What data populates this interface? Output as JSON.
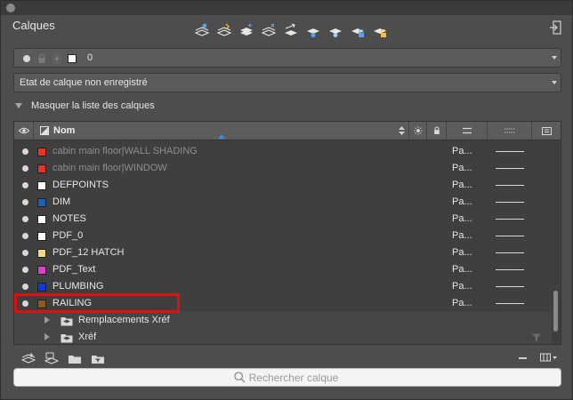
{
  "panel": {
    "title": "Calques"
  },
  "toolbar": {
    "icons": [
      "layer-match-icon",
      "layer-previous-icon",
      "layer-isolate-icon",
      "layer-unisolate-icon",
      "layer-walk-icon",
      "layer-freeze-icon",
      "layer-off-icon",
      "layer-lock-icon",
      "layer-unlock-icon"
    ]
  },
  "current_layer": {
    "name": "0",
    "color": "#ffffff"
  },
  "state": {
    "value": "Etat de calque non enregistré"
  },
  "toggle": {
    "label": "Masquer la liste des calques"
  },
  "list": {
    "header": {
      "name": "Nom"
    },
    "layers": [
      {
        "name": "cabin main floor|WALL SHADING",
        "color": "#e8322a",
        "linetype": "Pa...",
        "xref": true
      },
      {
        "name": "cabin main floor|WINDOW",
        "color": "#e8322a",
        "linetype": "Pa...",
        "xref": true
      },
      {
        "name": "DEFPOINTS",
        "color": "#ffffff",
        "linetype": "Pa...",
        "xref": false
      },
      {
        "name": "DIM",
        "color": "#1f5fb0",
        "linetype": "Pa...",
        "xref": false
      },
      {
        "name": "NOTES",
        "color": "#ffffff",
        "linetype": "Pa...",
        "xref": false
      },
      {
        "name": "PDF_0",
        "color": "#ffffff",
        "linetype": "Pa...",
        "xref": false
      },
      {
        "name": "PDF_12 HATCH",
        "color": "#f2d48a",
        "linetype": "Pa...",
        "xref": false
      },
      {
        "name": "PDF_Text",
        "color": "#e23fc8",
        "linetype": "Pa...",
        "xref": false
      },
      {
        "name": "PLUMBING",
        "color": "#1238d8",
        "linetype": "Pa...",
        "xref": false
      },
      {
        "name": "RAILING",
        "color": "#8a5a1e",
        "linetype": "Pa...",
        "xref": false
      }
    ],
    "groups": [
      {
        "name": "Remplacements Xréf"
      },
      {
        "name": "Xréf"
      }
    ]
  },
  "colors": {
    "highlight": "#e11010",
    "sort_indicator": "#3b8de0"
  },
  "search": {
    "placeholder": "Rechercher calque"
  }
}
